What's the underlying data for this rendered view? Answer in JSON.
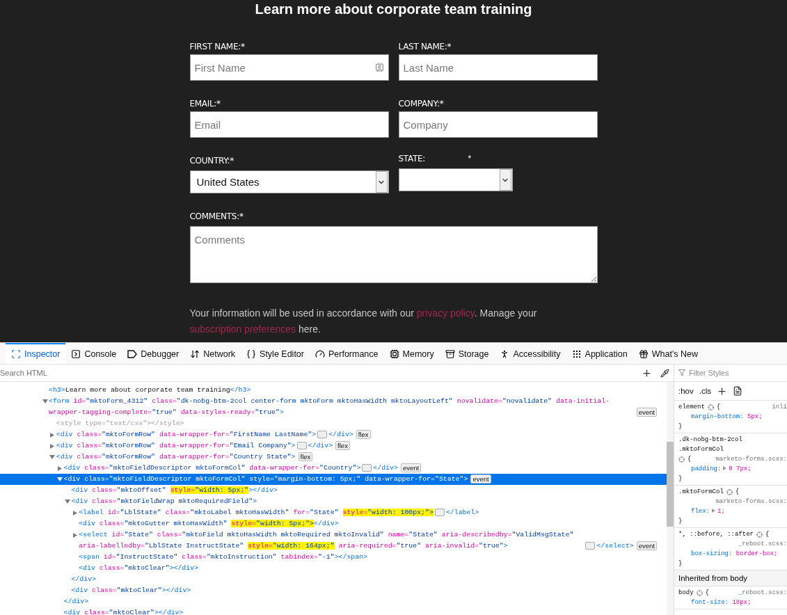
{
  "heading": "Learn more about corporate team training",
  "form": {
    "rows": [
      {
        "fields": [
          {
            "label": "FIRST NAME:*",
            "kind": "text",
            "placeholder": "First Name",
            "autofill_icon": true
          },
          {
            "label": "LAST NAME:*",
            "kind": "text",
            "placeholder": "Last Name",
            "autofill_icon": false
          }
        ]
      },
      {
        "fields": [
          {
            "label": "EMAIL:*",
            "kind": "text",
            "placeholder": "Email",
            "autofill_icon": false
          },
          {
            "label": "COMPANY:*",
            "kind": "text",
            "placeholder": "Company",
            "autofill_icon": false
          }
        ]
      },
      {
        "fields": [
          {
            "label": "COUNTRY:*",
            "kind": "select",
            "value": "United States"
          },
          {
            "label": "STATE:",
            "required_mark": "*",
            "kind": "short-select"
          }
        ]
      },
      {
        "fields": [
          {
            "label": "COMMENTS:*",
            "kind": "textarea",
            "placeholder": "Comments"
          }
        ]
      }
    ],
    "consent": [
      {
        "text": "Your information will be used in accordance with our "
      },
      {
        "text": "privacy policy",
        "link": true
      },
      {
        "text": ". Manage your "
      },
      {
        "text": "subscription preferences",
        "link": true
      },
      {
        "text": " here."
      }
    ]
  },
  "devtools": {
    "tabs": [
      {
        "label": "Inspector",
        "selected": true
      },
      {
        "label": "Console",
        "selected": false
      },
      {
        "label": "Debugger",
        "selected": false
      },
      {
        "label": "Network",
        "selected": false
      },
      {
        "label": "Style Editor",
        "selected": false
      },
      {
        "label": "Performance",
        "selected": false
      },
      {
        "label": "Memory",
        "selected": false
      },
      {
        "label": "Storage",
        "selected": false
      },
      {
        "label": "Accessibility",
        "selected": false
      },
      {
        "label": "Application",
        "selected": false
      },
      {
        "label": "What's New",
        "selected": false
      }
    ],
    "search": {
      "placeholder": "Search HTML"
    },
    "tree": [
      {
        "selected": false,
        "code": [
          {
            "kind": "tag",
            "text": "<h3>"
          },
          {
            "kind": "text",
            "text": "Learn more about corporate team training"
          },
          {
            "kind": "tag",
            "text": "</h3>"
          }
        ]
      },
      {
        "selected": false,
        "expanded": true,
        "code": [
          {
            "kind": "tag",
            "text": "<form"
          },
          {
            "kind": "attr",
            "text": " id="
          },
          {
            "kind": "value",
            "text": "\"mktoForm_4312\""
          },
          {
            "kind": "attr",
            "text": " class="
          },
          {
            "kind": "value",
            "text": "\"dk-nobg-btm-2col center-form mktoForm mktoHasWidth mktoLayoutLeft\""
          },
          {
            "kind": "attr",
            "text": " novalidate="
          },
          {
            "kind": "value",
            "text": "\"novalidate\""
          },
          {
            "kind": "attr",
            "text": " data-initial-wrapper-tagging-complete="
          },
          {
            "kind": "value",
            "text": "\"true\""
          },
          {
            "kind": "attr",
            "text": " data-styles-ready="
          },
          {
            "kind": "value",
            "text": "\"true\""
          },
          {
            "kind": "tag",
            "text": ">"
          },
          {
            "kind": "badge",
            "text": "event"
          }
        ],
        "children": [
          {
            "selected": false,
            "code": [
              {
                "kind": "dim",
                "text": "<style type=\"text/css\"></style>"
              }
            ]
          },
          {
            "selected": false,
            "expanded": false,
            "code": [
              {
                "kind": "tag",
                "text": "<div"
              },
              {
                "kind": "attr",
                "text": " class="
              },
              {
                "kind": "value",
                "text": "\"mktoFormRow\""
              },
              {
                "kind": "attr",
                "text": " data-wrapper-for="
              },
              {
                "kind": "value",
                "text": "\"FirstName LastName\""
              },
              {
                "kind": "tag",
                "text": ">"
              },
              {
                "kind": "more"
              },
              {
                "kind": "tag",
                "text": "</div>"
              },
              {
                "kind": "badge",
                "text": "flex"
              }
            ]
          },
          {
            "selected": false,
            "expanded": false,
            "code": [
              {
                "kind": "tag",
                "text": "<div"
              },
              {
                "kind": "attr",
                "text": " class="
              },
              {
                "kind": "value",
                "text": "\"mktoFormRow\""
              },
              {
                "kind": "attr",
                "text": " data-wrapper-for="
              },
              {
                "kind": "value",
                "text": "\"Email Company\""
              },
              {
                "kind": "tag",
                "text": ">"
              },
              {
                "kind": "more"
              },
              {
                "kind": "tag",
                "text": "</div>"
              },
              {
                "kind": "badge",
                "text": "flex"
              }
            ]
          },
          {
            "selected": false,
            "expanded": true,
            "code": [
              {
                "kind": "tag",
                "text": "<div"
              },
              {
                "kind": "attr",
                "text": " class="
              },
              {
                "kind": "value",
                "text": "\"mktoFormRow\""
              },
              {
                "kind": "attr",
                "text": " data-wrapper-for="
              },
              {
                "kind": "value",
                "text": "\"Country State\""
              },
              {
                "kind": "tag",
                "text": ">"
              },
              {
                "kind": "badge",
                "text": "flex"
              }
            ],
            "children": [
              {
                "selected": false,
                "expanded": false,
                "code": [
                  {
                    "kind": "tag",
                    "text": "<div"
                  },
                  {
                    "kind": "attr",
                    "text": " class="
                  },
                  {
                    "kind": "value",
                    "text": "\"mktoFieldDescriptor mktoFormCol\""
                  },
                  {
                    "kind": "attr",
                    "text": " data-wrapper-for="
                  },
                  {
                    "kind": "value",
                    "text": "\"Country\""
                  },
                  {
                    "kind": "tag",
                    "text": ">"
                  },
                  {
                    "kind": "more"
                  },
                  {
                    "kind": "tag",
                    "text": "</div>"
                  },
                  {
                    "kind": "badge",
                    "text": "event"
                  }
                ]
              },
              {
                "selected": true,
                "expanded": true,
                "code": [
                  {
                    "kind": "tag",
                    "text": "<div"
                  },
                  {
                    "kind": "attr",
                    "text": " class="
                  },
                  {
                    "kind": "value",
                    "text": "\"mktoFieldDescriptor mktoFormCol\""
                  },
                  {
                    "kind": "attr",
                    "text": " style="
                  },
                  {
                    "kind": "value",
                    "text": "\"margin-bottom: 5px;\""
                  },
                  {
                    "kind": "attr",
                    "text": " data-wrapper-for="
                  },
                  {
                    "kind": "value",
                    "text": "\"State\""
                  },
                  {
                    "kind": "tag",
                    "text": ">"
                  },
                  {
                    "kind": "badge",
                    "text": "event"
                  }
                ],
                "closing": [
                  {
                    "kind": "tag",
                    "text": "</div>"
                  }
                ],
                "children": [
                  {
                    "selected": false,
                    "code": [
                      {
                        "kind": "tag",
                        "text": "<div"
                      },
                      {
                        "kind": "attr",
                        "text": " class="
                      },
                      {
                        "kind": "value",
                        "text": "\"mktoOffset\" "
                      },
                      {
                        "kind": "attr",
                        "text": "style=",
                        "highlighted": true
                      },
                      {
                        "kind": "value",
                        "text": "\"width: 5px;\"",
                        "highlighted": true
                      },
                      {
                        "kind": "tag",
                        "text": "></div>"
                      }
                    ]
                  },
                  {
                    "selected": false,
                    "expanded": true,
                    "code": [
                      {
                        "kind": "tag",
                        "text": "<div"
                      },
                      {
                        "kind": "attr",
                        "text": " class="
                      },
                      {
                        "kind": "value",
                        "text": "\"mktoFieldWrap mktoRequiredField\""
                      },
                      {
                        "kind": "tag",
                        "text": ">"
                      }
                    ],
                    "closing": [
                      {
                        "kind": "tag",
                        "text": "</div>"
                      }
                    ],
                    "children": [
                      {
                        "selected": false,
                        "expanded": false,
                        "code": [
                          {
                            "kind": "tag",
                            "text": "<label"
                          },
                          {
                            "kind": "attr",
                            "text": " id="
                          },
                          {
                            "kind": "value",
                            "text": "\"LblState\""
                          },
                          {
                            "kind": "attr",
                            "text": " class="
                          },
                          {
                            "kind": "value",
                            "text": "\"mktoLabel mktoHasWidth\""
                          },
                          {
                            "kind": "attr",
                            "text": " for="
                          },
                          {
                            "kind": "value",
                            "text": "\"State\" "
                          },
                          {
                            "kind": "attr",
                            "text": "style=",
                            "highlighted": true
                          },
                          {
                            "kind": "value",
                            "text": "\"width: 100px;\">",
                            "highlighted": true
                          },
                          {
                            "kind": "more"
                          },
                          {
                            "kind": "tag",
                            "text": "</label>"
                          }
                        ]
                      },
                      {
                        "selected": false,
                        "code": [
                          {
                            "kind": "tag",
                            "text": "<div"
                          },
                          {
                            "kind": "attr",
                            "text": " class="
                          },
                          {
                            "kind": "value",
                            "text": "\"mktoGutter mktoHasWidth\" "
                          },
                          {
                            "kind": "attr",
                            "text": "style=",
                            "highlighted": true
                          },
                          {
                            "kind": "value",
                            "text": "\"width: 5px;\">",
                            "highlighted": true
                          },
                          {
                            "kind": "tag",
                            "text": "</div>"
                          }
                        ]
                      },
                      {
                        "selected": false,
                        "expanded": false,
                        "code": [
                          {
                            "kind": "tag",
                            "text": "<select"
                          },
                          {
                            "kind": "attr",
                            "text": " id="
                          },
                          {
                            "kind": "value",
                            "text": "\"State\""
                          },
                          {
                            "kind": "attr",
                            "text": " class="
                          },
                          {
                            "kind": "value",
                            "text": "\"mktoField mktoHasWidth mktoRequired mktoInvalid\""
                          },
                          {
                            "kind": "attr",
                            "text": " name="
                          },
                          {
                            "kind": "value",
                            "text": "\"State\""
                          },
                          {
                            "kind": "attr",
                            "text": " aria-describedby="
                          },
                          {
                            "kind": "value",
                            "text": "\"ValidMsgState\""
                          },
                          {
                            "kind": "attr",
                            "text": " aria-labelledby="
                          },
                          {
                            "kind": "value",
                            "text": "\"LblState InstructState\" "
                          },
                          {
                            "kind": "attr",
                            "text": "style=",
                            "highlighted": true
                          },
                          {
                            "kind": "value",
                            "text": "\"width: 164px;\"",
                            "highlighted": true
                          },
                          {
                            "kind": "attr",
                            "text": " aria-required="
                          },
                          {
                            "kind": "value",
                            "text": "\"true\""
                          },
                          {
                            "kind": "attr",
                            "text": " aria-invalid="
                          },
                          {
                            "kind": "value",
                            "text": "\"true\""
                          },
                          {
                            "kind": "tag",
                            "text": ">"
                          },
                          {
                            "kind": "more"
                          },
                          {
                            "kind": "tag",
                            "text": "</select>"
                          },
                          {
                            "kind": "badge",
                            "text": "event"
                          }
                        ]
                      },
                      {
                        "selected": false,
                        "code": [
                          {
                            "kind": "tag",
                            "text": "<span"
                          },
                          {
                            "kind": "attr",
                            "text": " id="
                          },
                          {
                            "kind": "value",
                            "text": "\"InstructState\""
                          },
                          {
                            "kind": "attr",
                            "text": " class="
                          },
                          {
                            "kind": "value",
                            "text": "\"mktoInstruction\""
                          },
                          {
                            "kind": "attr",
                            "text": " tabindex="
                          },
                          {
                            "kind": "value",
                            "text": "\"-1\""
                          },
                          {
                            "kind": "tag",
                            "text": "></span>"
                          }
                        ]
                      },
                      {
                        "selected": false,
                        "code": [
                          {
                            "kind": "tag",
                            "text": "<div"
                          },
                          {
                            "kind": "attr",
                            "text": " class="
                          },
                          {
                            "kind": "value",
                            "text": "\"mktoClear\""
                          },
                          {
                            "kind": "tag",
                            "text": "></div>"
                          }
                        ]
                      }
                    ]
                  },
                  {
                    "selected": false,
                    "code": [
                      {
                        "kind": "tag",
                        "text": "<div"
                      },
                      {
                        "kind": "attr",
                        "text": " class="
                      },
                      {
                        "kind": "value",
                        "text": "\"mktoClear\""
                      },
                      {
                        "kind": "tag",
                        "text": "></div>"
                      }
                    ]
                  }
                ]
              },
              {
                "selected": false,
                "code": [
                  {
                    "kind": "tag",
                    "text": "<div"
                  },
                  {
                    "kind": "attr",
                    "text": " class="
                  },
                  {
                    "kind": "value",
                    "text": "\"mktoClear\""
                  },
                  {
                    "kind": "tag",
                    "text": "></div>"
                  }
                ]
              }
            ]
          }
        ]
      }
    ],
    "styles": {
      "filter": {
        "placeholder": "Filter Styles"
      },
      "toggles": [
        ":hov",
        ".cls"
      ],
      "rules": [
        {
          "selector": "element",
          "brace": "{",
          "source": "inli",
          "declarations": [
            {
              "property": "margin-bottom:",
              "value": "5px;"
            }
          ],
          "close": "}"
        },
        {
          "selector": ".dk-nobg-btm-2col .mktoFormCol",
          "brace": "{",
          "source": "marketo-forms.scss:",
          "declarations": [
            {
              "property": "padding:",
              "value": "0 7px;",
              "expandable": true
            }
          ],
          "close": "}"
        },
        {
          "selector": ".mktoFormCol",
          "brace": "{",
          "source": "marketo-forms.scss:",
          "declarations": [
            {
              "property": "flex:",
              "value": "1;",
              "expandable": true
            }
          ],
          "close": "}"
        },
        {
          "selector": "*, ::before, ::after",
          "brace": "{",
          "source": "_reboot.scss:",
          "declarations": [
            {
              "property": "box-sizing:",
              "value": "border-box;"
            }
          ],
          "close": "}"
        }
      ],
      "inherited_header": "Inherited from body",
      "inherited_rules": [
        {
          "selector": "body",
          "brace": "{",
          "source": "_reboot.scss:",
          "declarations": [
            {
              "property": "font-size:",
              "value": "18px;"
            }
          ]
        }
      ]
    }
  }
}
